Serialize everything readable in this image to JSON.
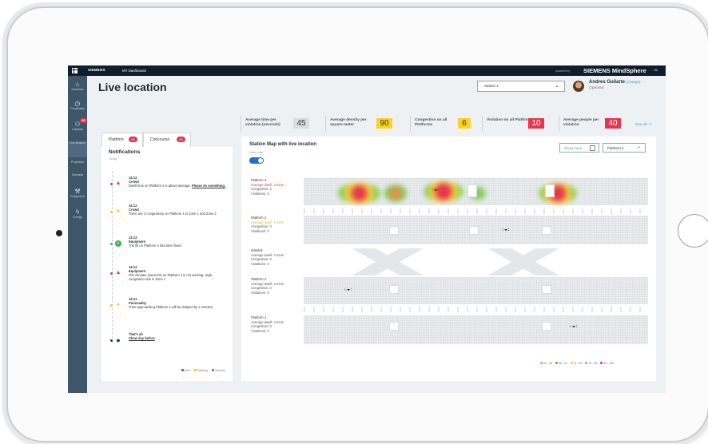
{
  "topbar": {
    "brand": "SIEMENS",
    "app": "MT Dashboard",
    "powered": "powered by",
    "platform": "SIEMENS MindSphere"
  },
  "sidebar": {
    "items": [
      {
        "label": "Overview",
        "icon": "home-icon"
      },
      {
        "label": "Punctuality",
        "icon": "clock-icon"
      },
      {
        "label": "Capacity",
        "icon": "people-icon",
        "badge": "92"
      },
      {
        "label": "Live location",
        "icon": "location-icon"
      },
      {
        "label": "Projection",
        "icon": "projection-icon"
      },
      {
        "label": "Scenario",
        "icon": "scenario-icon"
      },
      {
        "label": "Equipment",
        "icon": "wrench-icon"
      },
      {
        "label": "Energy",
        "icon": "bolt-icon"
      }
    ]
  },
  "page": {
    "title": "Live location"
  },
  "station_select": {
    "value": "Station 1"
  },
  "user": {
    "name": "Andres Guilarte",
    "change": "(change)",
    "role": "Operator"
  },
  "kpis": [
    {
      "label": "Average time per violation (seconds)",
      "value": "45",
      "color": "#d9dde1",
      "text": "#333333"
    },
    {
      "label": "Average density per square meter",
      "value": "90",
      "color": "#ffd21f",
      "text": "#333333"
    },
    {
      "label": "Congestion on all Platforms",
      "value": "6",
      "color": "#ffd21f",
      "text": "#333333"
    },
    {
      "label": "Violation on all Platforms",
      "value": "10",
      "color": "#e8354d",
      "text": "#ffffff"
    },
    {
      "label": "Average people per violation",
      "value": "40",
      "color": "#e8354d",
      "text": "#ffffff"
    }
  ],
  "see_all": "See all ↗",
  "tabs": [
    {
      "label": "Platform",
      "count": "04"
    },
    {
      "label": "Concourse",
      "count": "04"
    }
  ],
  "notifications": {
    "title": "Notifications",
    "subtitle": "Today",
    "items": [
      {
        "time": "14:12",
        "category": "Crowd",
        "text": "Dwell time on Platform 4 is above average.",
        "link": "Please do something.",
        "status": "alert"
      },
      {
        "time": "14:12",
        "category": "Crowd",
        "text": "There are 2 congestions on Platform 4 in Zone 1 and Zone 2",
        "link": "",
        "status": "warning"
      },
      {
        "time": "14:12",
        "category": "Equipment",
        "text": "The lift on Platform 4 has been fixed.",
        "link": "",
        "status": "success"
      },
      {
        "time": "14:12",
        "category": "Equipment",
        "text": "The elevator (asset ID) on Platform 4 is not working. High congestion rate in Zone 1",
        "link": "",
        "status": "alert"
      },
      {
        "time": "14:12",
        "category": "Punctuality",
        "text": "Train approaching Platform 4 will be delayed by 2 minutes.",
        "link": "",
        "status": "warning"
      },
      {
        "time": "",
        "category": "That's all",
        "text": "",
        "link": "Show day before",
        "status": "end"
      }
    ],
    "legend": [
      "Alert",
      "Warning",
      "Success"
    ]
  },
  "map": {
    "title": "Station Map with live location",
    "subtitle": "Heat map",
    "show_zone": "Show zone",
    "platform_select": "Platform 4",
    "platforms": [
      {
        "name": "Platform 4",
        "dwell": "Average dwell: 3 mins",
        "congestion": "Congestion: 2",
        "violations": "Violations: 0",
        "dwell_status": "red"
      },
      {
        "name": "Platform 3",
        "dwell": "Average dwell: 2 mins",
        "congestion": "Congestion: 0",
        "violations": "Violations: 0",
        "dwell_status": "yellow"
      },
      {
        "name": "Interlink",
        "dwell": "Average dwell: 3 mins",
        "congestion": "Congestion: 0",
        "violations": "Violations: 0",
        "dwell_status": ""
      },
      {
        "name": "Platform 2",
        "dwell": "Average dwell: 3 mins",
        "congestion": "Congestion: 0",
        "violations": "Violations: 0",
        "dwell_status": ""
      },
      {
        "name": "Platform 1",
        "dwell": "Average dwell: 3 mins",
        "congestion": "Congestion: 0",
        "violations": "Violations: 0",
        "dwell_status": ""
      }
    ],
    "scale": [
      {
        "label": "00 - 05",
        "color": "#7fcf5a"
      },
      {
        "label": "06 - 10",
        "color": "#3fb34f"
      },
      {
        "label": "11 - 20",
        "color": "#ffd21f"
      },
      {
        "label": "21 - 50",
        "color": "#f08a4b"
      },
      {
        "label": "51 - 100",
        "color": "#e8354d"
      }
    ]
  },
  "colors": {
    "alert": "#e8354d",
    "warning": "#ffc21a",
    "success": "#3fb34f",
    "end": "#1e3a4f",
    "accent": "#27a8c9"
  }
}
